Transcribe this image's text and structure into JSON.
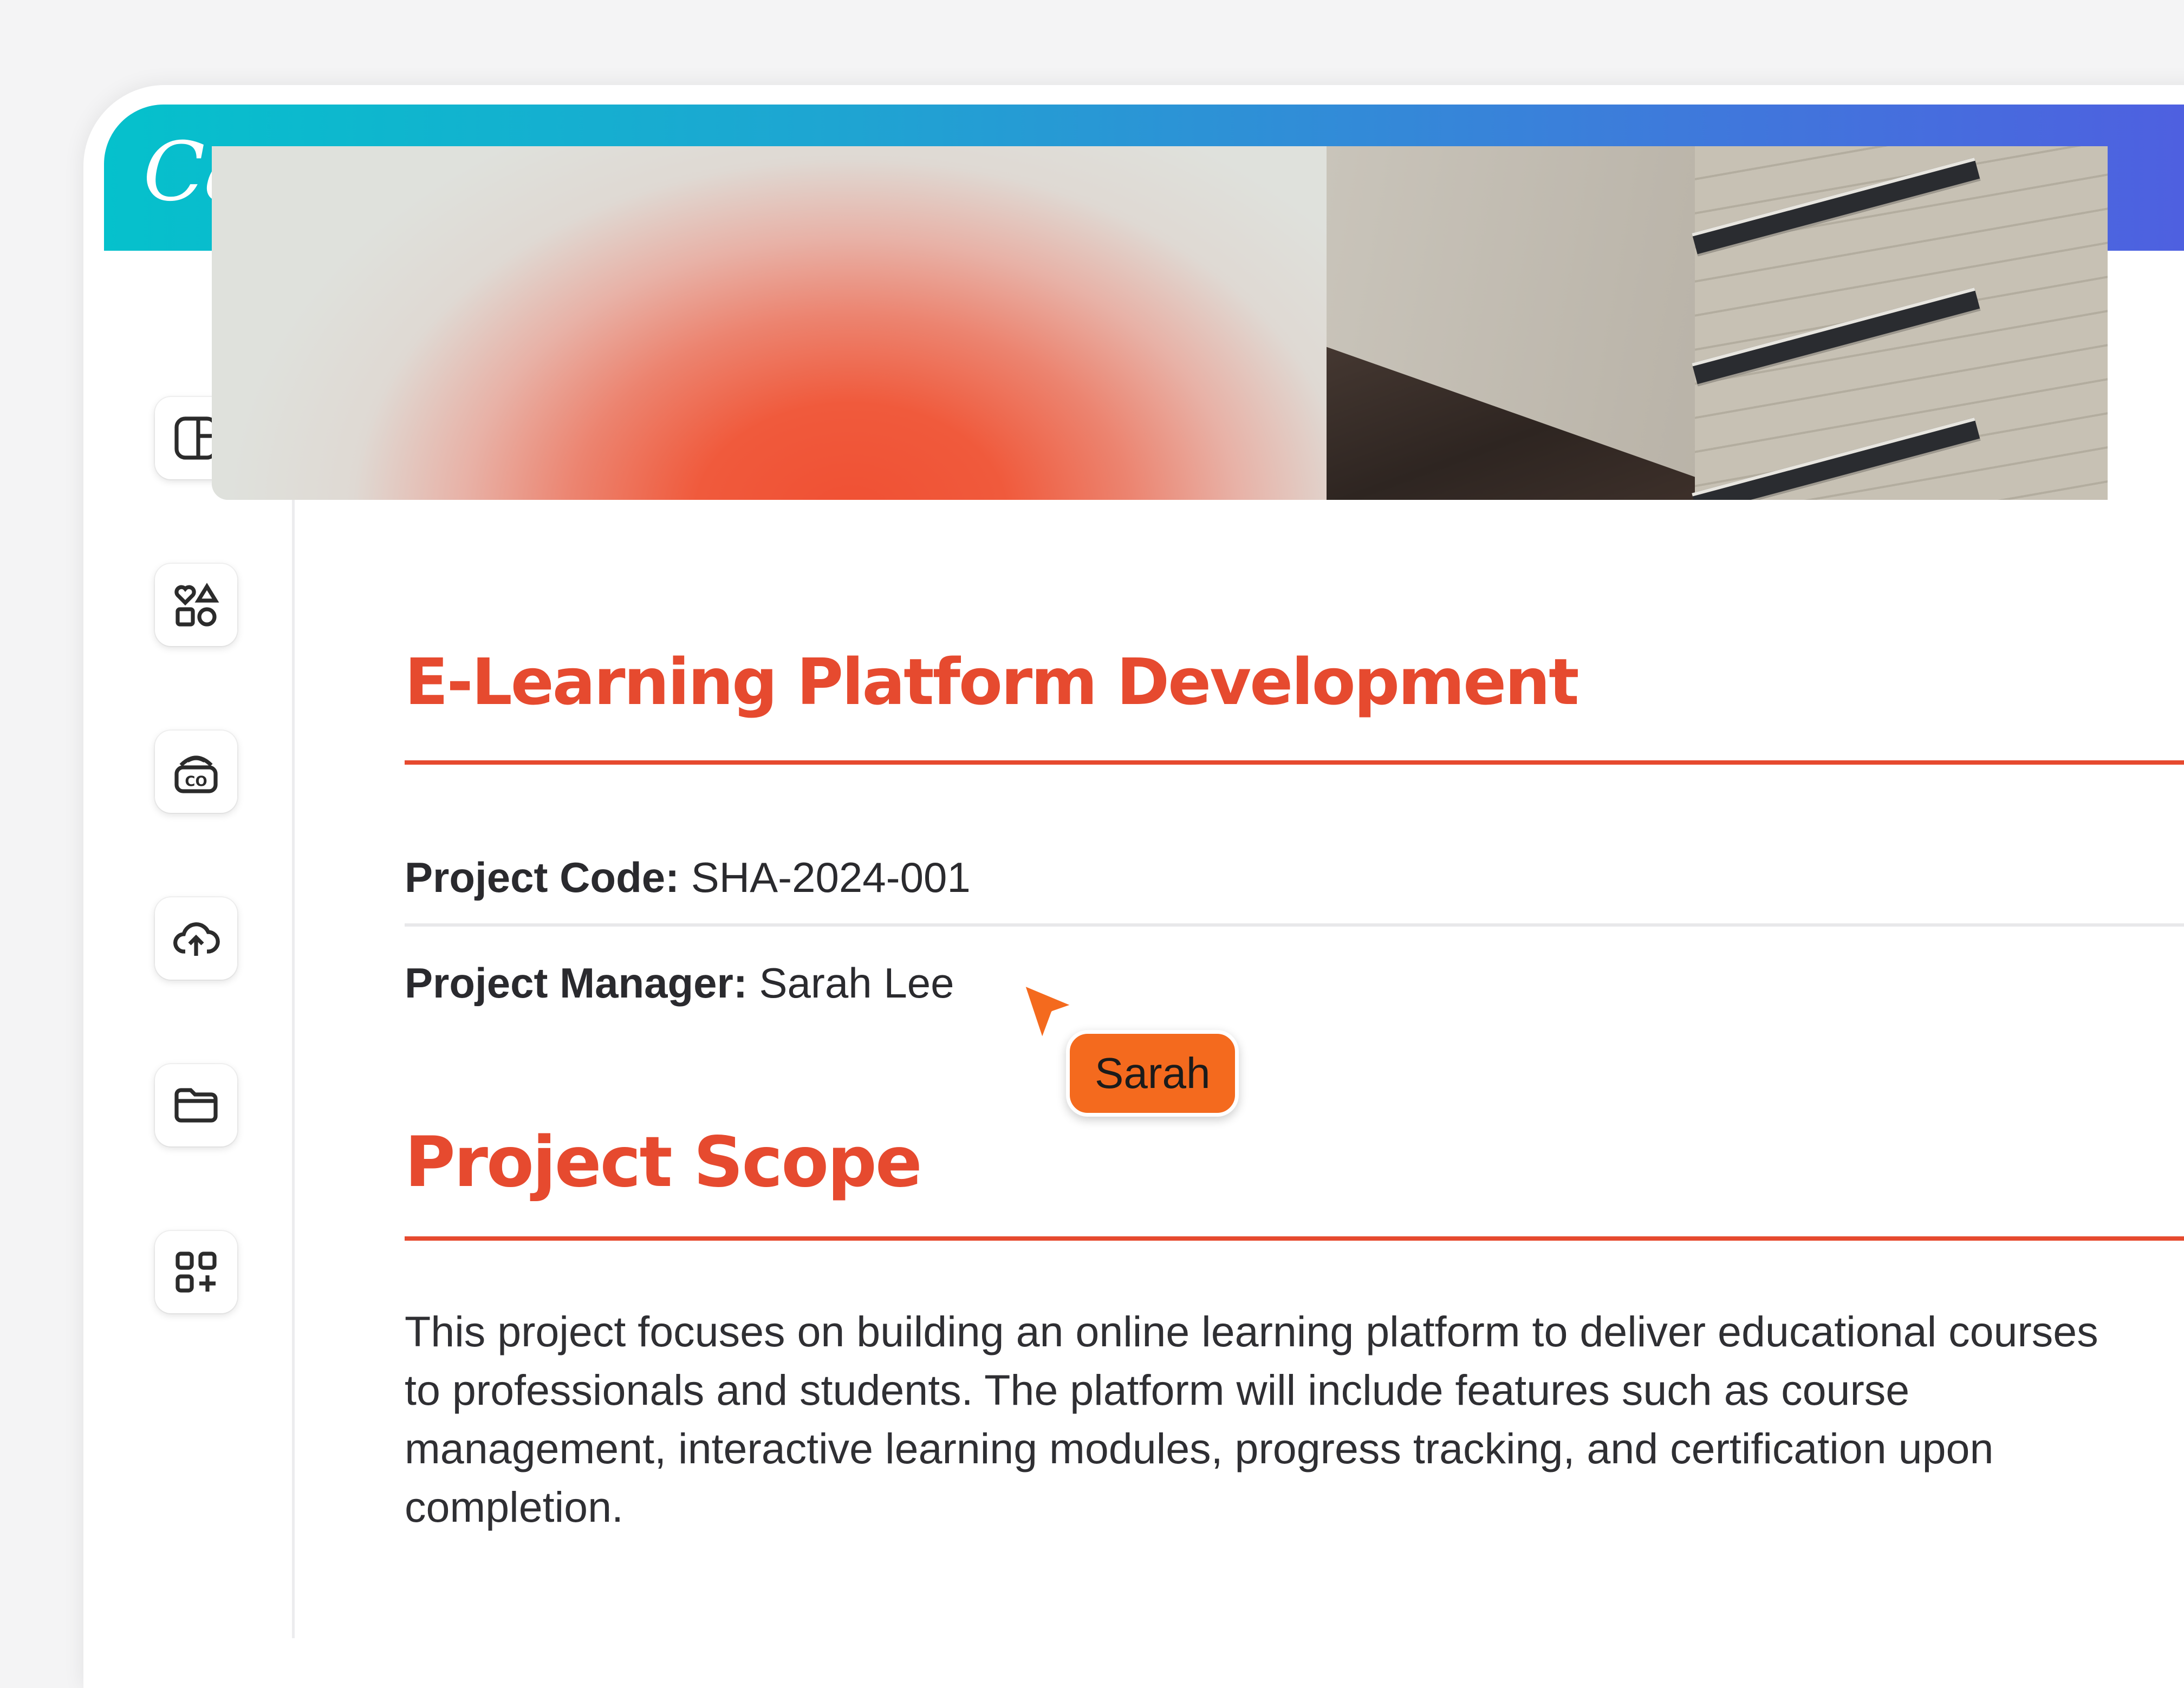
{
  "app": {
    "logo_text": "Canva",
    "accent_color": "#e64a2f",
    "topbar_gradient": [
      "#05c1cc",
      "#4e60e0"
    ]
  },
  "sidebar": {
    "items": [
      {
        "icon": "layout-icon",
        "name": "Design"
      },
      {
        "icon": "elements-icon",
        "name": "Elements"
      },
      {
        "icon": "brand-icon",
        "name": "Brand"
      },
      {
        "icon": "upload-cloud-icon",
        "name": "Uploads"
      },
      {
        "icon": "folder-icon",
        "name": "Projects"
      },
      {
        "icon": "apps-icon",
        "name": "Apps"
      }
    ]
  },
  "document": {
    "title": "E-Learning Platform Development",
    "project_code_label": "Project Code:",
    "project_code_value": " SHA-2024-001",
    "project_manager_label": "Project Manager:",
    "project_manager_value": " Sarah Lee",
    "section_title": "Project Scope",
    "body": "This project focuses on building an online learning platform to deliver educational courses to professionals and students. The platform will include features such as course management, interactive learning modules, progress tracking, and certification upon completion."
  },
  "collaborator": {
    "name": "Sarah",
    "color": "#f46a1e"
  }
}
